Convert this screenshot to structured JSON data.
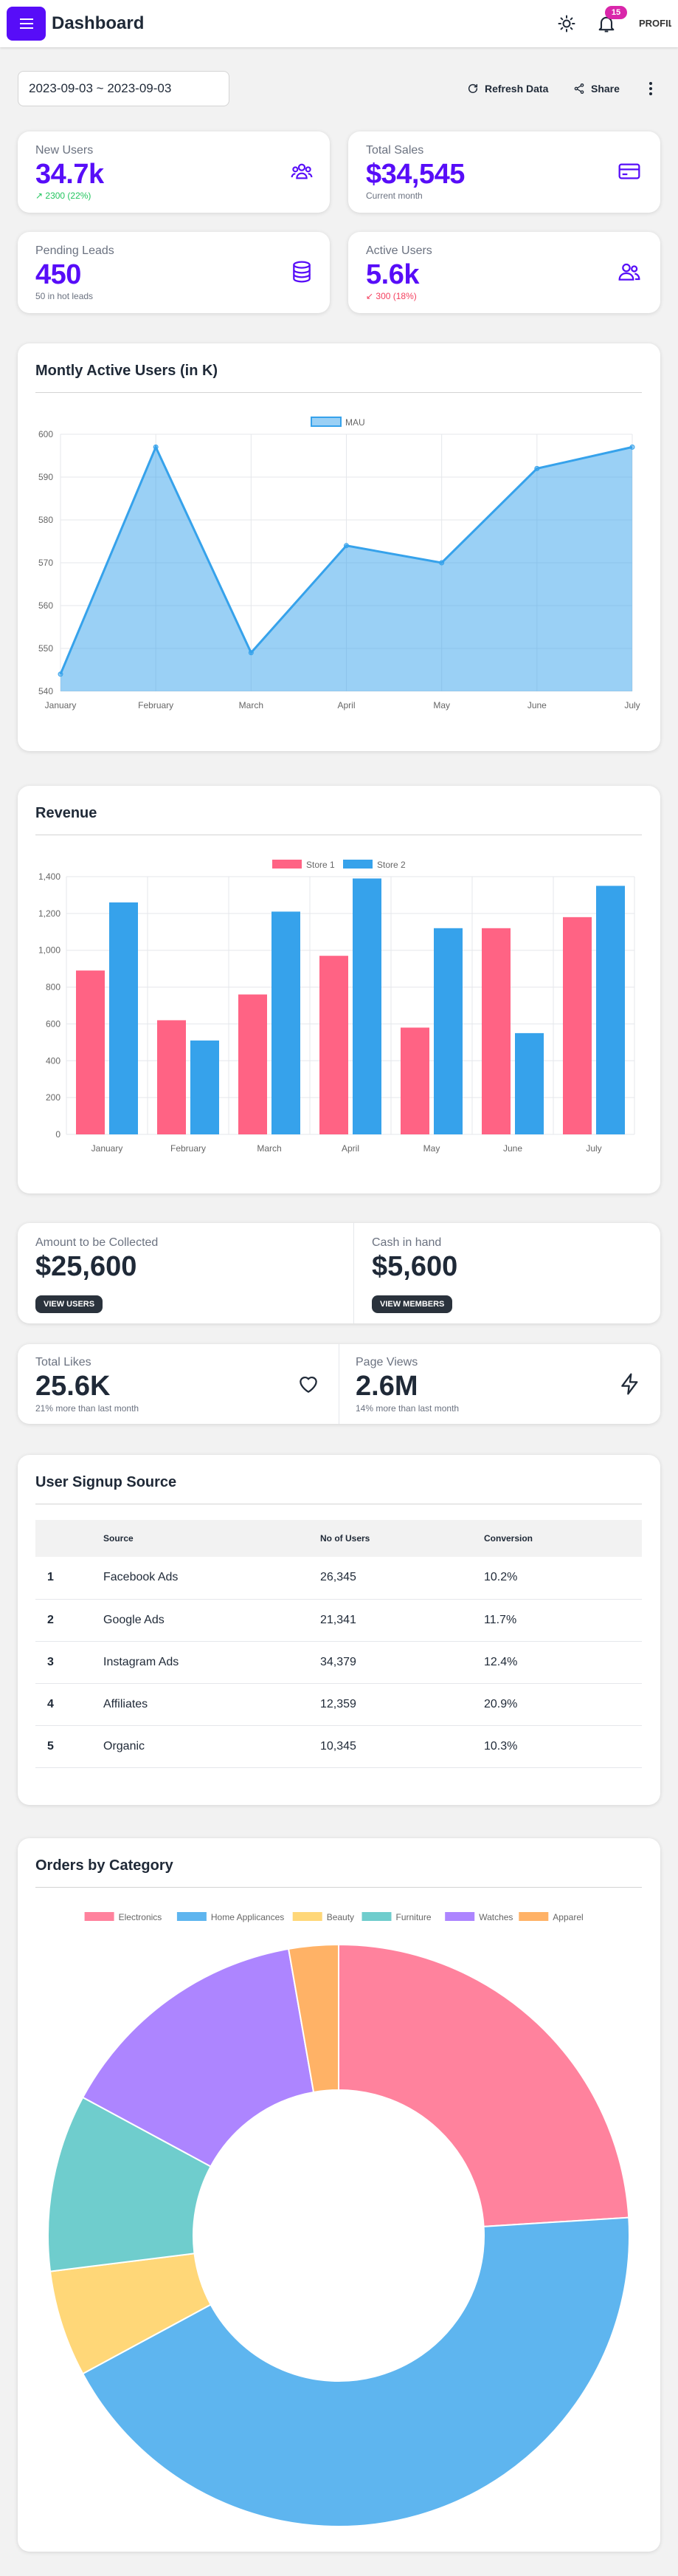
{
  "header": {
    "title": "Dashboard",
    "notification_count": "15",
    "profile_label": "PROFILE"
  },
  "toolbar": {
    "date_range": "2023-09-03 ~ 2023-09-03",
    "refresh_label": "Refresh Data",
    "share_label": "Share"
  },
  "stats": [
    {
      "title": "New Users",
      "value": "34.7k",
      "desc": "↗︎ 2300 (22%)",
      "desc_color": "#22c55e",
      "icon": "users-group-icon"
    },
    {
      "title": "Total Sales",
      "value": "$34,545",
      "desc": "Current month",
      "desc_color": "#6b7280",
      "icon": "credit-card-icon"
    },
    {
      "title": "Pending Leads",
      "value": "450",
      "desc": "50 in hot leads",
      "desc_color": "#6b7280",
      "icon": "database-icon"
    },
    {
      "title": "Active Users",
      "value": "5.6k",
      "desc": "↙ 300 (18%)",
      "desc_color": "#f43f5e",
      "icon": "users-icon"
    }
  ],
  "mau_chart": {
    "title": "Montly Active Users (in K)"
  },
  "revenue_chart": {
    "title": "Revenue"
  },
  "summary": {
    "collected_title": "Amount to be Collected",
    "collected_value": "$25,600",
    "collected_button": "VIEW USERS",
    "cash_title": "Cash in hand",
    "cash_value": "$5,600",
    "cash_button": "VIEW MEMBERS",
    "likes_title": "Total Likes",
    "likes_value": "25.6K",
    "likes_desc": "21% more than last month",
    "views_title": "Page Views",
    "views_value": "2.6M",
    "views_desc": "14% more than last month"
  },
  "signup_table": {
    "title": "User Signup Source",
    "columns": [
      "",
      "Source",
      "No of Users",
      "Conversion"
    ],
    "rows": [
      [
        "1",
        "Facebook Ads",
        "26,345",
        "10.2%"
      ],
      [
        "2",
        "Google Ads",
        "21,341",
        "11.7%"
      ],
      [
        "3",
        "Instagram Ads",
        "34,379",
        "12.4%"
      ],
      [
        "4",
        "Affiliates",
        "12,359",
        "20.9%"
      ],
      [
        "5",
        "Organic",
        "10,345",
        "10.3%"
      ]
    ]
  },
  "orders_chart": {
    "title": "Orders by Category"
  },
  "colors": {
    "primary": "#570df8",
    "blue": "#36a2eb",
    "pink": "#ff6384",
    "yellow": "#ffcd56",
    "teal": "#4bc0c0",
    "purple": "#9966ff",
    "orange": "#ff9f40"
  },
  "chart_data": [
    {
      "type": "area",
      "title": "Montly Active Users (in K)",
      "x": [
        "January",
        "February",
        "March",
        "April",
        "May",
        "June",
        "July"
      ],
      "series": [
        {
          "name": "MAU",
          "values": [
            544,
            597,
            549,
            574,
            570,
            592,
            597
          ]
        }
      ],
      "ylim": [
        540,
        600
      ],
      "yticks": [
        540,
        550,
        560,
        570,
        580,
        590,
        600
      ],
      "grid": true,
      "legend": "top-center",
      "colors": [
        "#36a2eb"
      ]
    },
    {
      "type": "bar",
      "title": "Revenue",
      "categories": [
        "January",
        "February",
        "March",
        "April",
        "May",
        "June",
        "July"
      ],
      "series": [
        {
          "name": "Store 1",
          "values": [
            890,
            620,
            760,
            970,
            580,
            1120,
            1180
          ]
        },
        {
          "name": "Store 2",
          "values": [
            1260,
            510,
            1210,
            1390,
            1120,
            550,
            1350
          ]
        }
      ],
      "ylim": [
        0,
        1400
      ],
      "yticks": [
        "0",
        "200",
        "400",
        "600",
        "800",
        "1,000",
        "1,200",
        "1,400"
      ],
      "grid": true,
      "legend": "top-center",
      "colors": [
        "#ff6384",
        "#36a2eb"
      ]
    },
    {
      "type": "pie",
      "title": "Orders by Category",
      "labels": [
        "Electronics",
        "Home Applicances",
        "Beauty",
        "Furniture",
        "Watches",
        "Apparel"
      ],
      "values": [
        122,
        219,
        30,
        50,
        73,
        14
      ],
      "legend": "top-center",
      "colors": [
        "#ff6384",
        "#36a2eb",
        "#ffcd56",
        "#4bc0c0",
        "#9966ff",
        "#ff9f40"
      ]
    }
  ]
}
